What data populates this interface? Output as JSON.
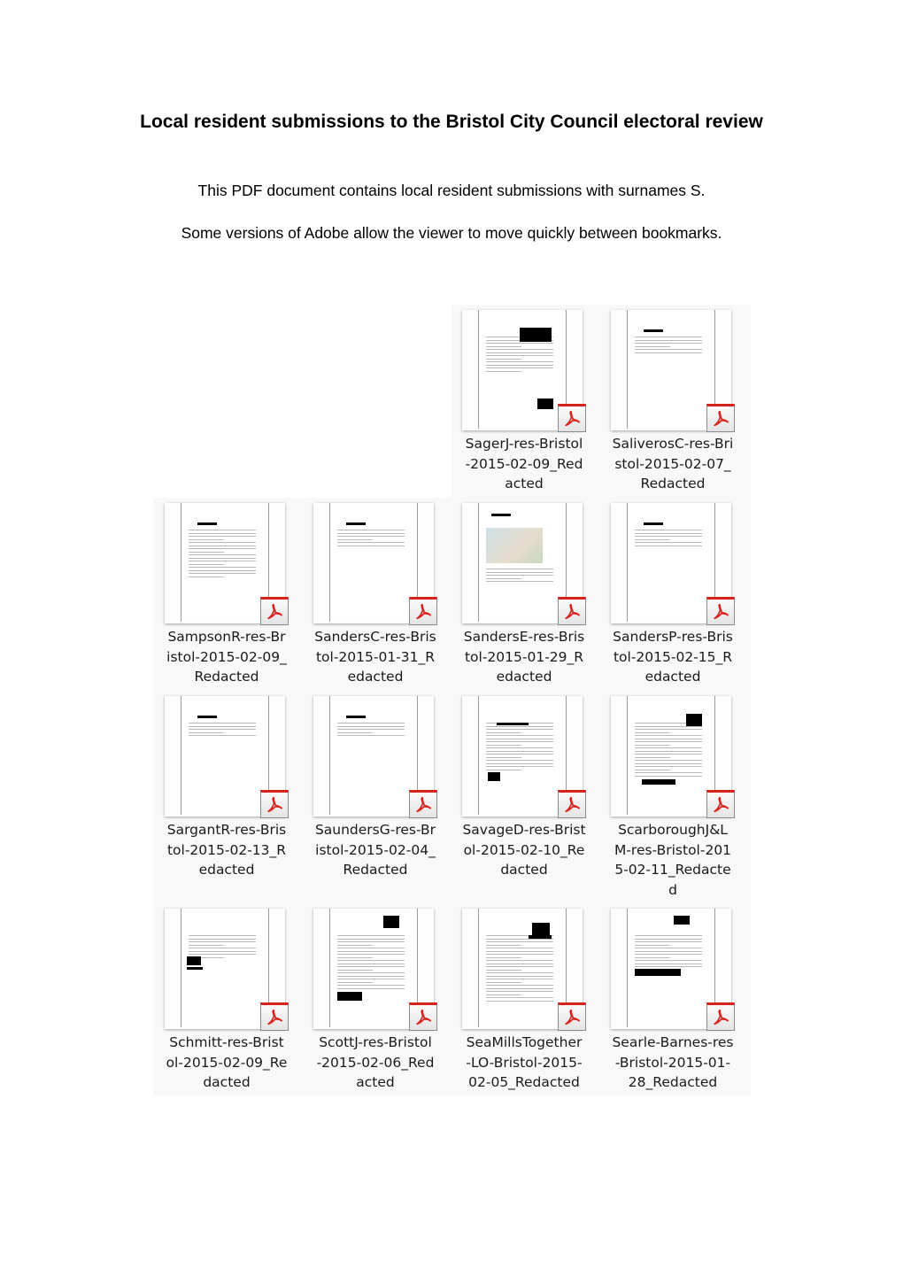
{
  "document": {
    "title": "Local resident submissions to the Bristol City Council electoral review",
    "intro": "This PDF document contains local resident submissions with surnames S.",
    "note": "Some versions of Adobe allow the viewer to move quickly between bookmarks."
  },
  "files": [
    {
      "lines": [
        "SagerJ-res-Bristol",
        "-2015-02-09_Red",
        "acted"
      ],
      "icon": "pdf-icon"
    },
    {
      "lines": [
        "SaliverosC-res-Bri",
        "stol-2015-02-07_",
        "Redacted"
      ],
      "icon": "pdf-icon"
    },
    {
      "lines": [
        "SampsonR-res-Br",
        "istol-2015-02-09_",
        "Redacted"
      ],
      "icon": "pdf-icon"
    },
    {
      "lines": [
        "SandersC-res-Bris",
        "tol-2015-01-31_R",
        "edacted"
      ],
      "icon": "pdf-icon"
    },
    {
      "lines": [
        "SandersE-res-Bris",
        "tol-2015-01-29_R",
        "edacted"
      ],
      "icon": "pdf-icon"
    },
    {
      "lines": [
        "SandersP-res-Bris",
        "tol-2015-02-15_R",
        "edacted"
      ],
      "icon": "pdf-icon"
    },
    {
      "lines": [
        "SargantR-res-Bris",
        "tol-2015-02-13_R",
        "edacted"
      ],
      "icon": "pdf-icon"
    },
    {
      "lines": [
        "SaundersG-res-Br",
        "istol-2015-02-04_",
        "Redacted"
      ],
      "icon": "pdf-icon"
    },
    {
      "lines": [
        "SavageD-res-Brist",
        "ol-2015-02-10_Re",
        "dacted"
      ],
      "icon": "pdf-icon"
    },
    {
      "lines": [
        "ScarboroughJ&L",
        "M-res-Bristol-201",
        "5-02-11_Redacte",
        "d"
      ],
      "icon": "pdf-icon"
    },
    {
      "lines": [
        "Schmitt-res-Brist",
        "ol-2015-02-09_Re",
        "dacted"
      ],
      "icon": "pdf-icon"
    },
    {
      "lines": [
        "ScottJ-res-Bristol",
        "-2015-02-06_Red",
        "acted"
      ],
      "icon": "pdf-icon"
    },
    {
      "lines": [
        "SeaMillsTogether",
        "-LO-Bristol-2015-",
        "02-05_Redacted"
      ],
      "icon": "pdf-icon"
    },
    {
      "lines": [
        "Searle-Barnes-res",
        "-Bristol-2015-01-",
        "28_Redacted"
      ],
      "icon": "pdf-icon"
    }
  ],
  "colors": {
    "pdf_red": "#d9211c",
    "panel_bg": "#f8f8f8"
  }
}
